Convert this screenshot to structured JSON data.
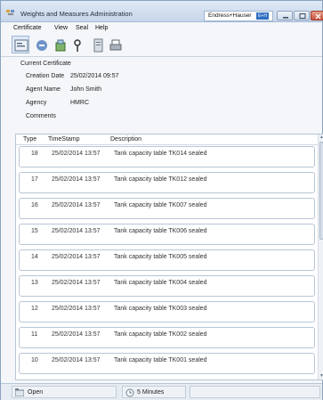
{
  "window": {
    "title": "Weights and Measures Administration",
    "brand": "Endress+Hauser",
    "brand_badge": "E+H"
  },
  "menu": [
    "Certificate",
    "View",
    "Seal",
    "Help"
  ],
  "toolbar": {
    "icons": [
      "certificate-icon",
      "edit-icon",
      "tank-seal-icon",
      "key-icon",
      "document-icon",
      "printer-icon"
    ]
  },
  "certificate": {
    "group_title": "Current Certificate",
    "fields": [
      {
        "label": "Creation Date",
        "value": "25/02/2014 09:57"
      },
      {
        "label": "Agent Name",
        "value": "John Smith"
      },
      {
        "label": "Agency",
        "value": "HMRC"
      },
      {
        "label": "Comments",
        "value": ""
      }
    ]
  },
  "table": {
    "headers": [
      "Type",
      "TimeStamp",
      "Description"
    ],
    "rows": [
      {
        "type": "18",
        "timestamp": "25/02/2014 13:57",
        "description": "Tank capacity table TK014 sealed"
      },
      {
        "type": "17",
        "timestamp": "25/02/2014 13:57",
        "description": "Tank capacity table TK012 sealed"
      },
      {
        "type": "16",
        "timestamp": "25/02/2014 13:57",
        "description": "Tank capacity table TK007 sealed"
      },
      {
        "type": "15",
        "timestamp": "25/02/2014 13:57",
        "description": "Tank capacity table TK006 sealed"
      },
      {
        "type": "14",
        "timestamp": "25/02/2014 13:57",
        "description": "Tank capacity table TK005 sealed"
      },
      {
        "type": "13",
        "timestamp": "25/02/2014 13:57",
        "description": "Tank capacity table TK004 sealed"
      },
      {
        "type": "12",
        "timestamp": "25/02/2014 13:57",
        "description": "Tank capacity table TK003 sealed"
      },
      {
        "type": "11",
        "timestamp": "25/02/2014 13:57",
        "description": "Tank capacity table TK002 sealed"
      },
      {
        "type": "10",
        "timestamp": "25/02/2014 13:57",
        "description": "Tank capacity table TK001 sealed"
      }
    ]
  },
  "status": {
    "state": "Open",
    "interval": "5 Minutes"
  }
}
